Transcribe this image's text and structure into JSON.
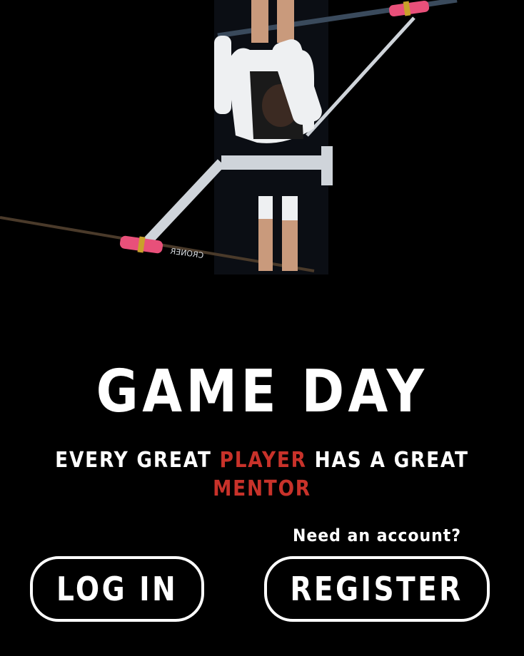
{
  "hero": {
    "alt": "Overhead view of a rower in a single scull",
    "oar_brand": "CRONER"
  },
  "title": "GAME DAY",
  "tagline": {
    "part1": "EVERY GREAT ",
    "accent1": "PLAYER",
    "part2": " HAS A GREAT ",
    "accent2": "MENTOR"
  },
  "auth": {
    "need_account": "Need an account?",
    "login_label": "LOG IN",
    "register_label": "REGISTER"
  },
  "colors": {
    "background": "#000000",
    "text": "#ffffff",
    "accent": "#c8322a",
    "oar_grip": "#e8507a"
  }
}
